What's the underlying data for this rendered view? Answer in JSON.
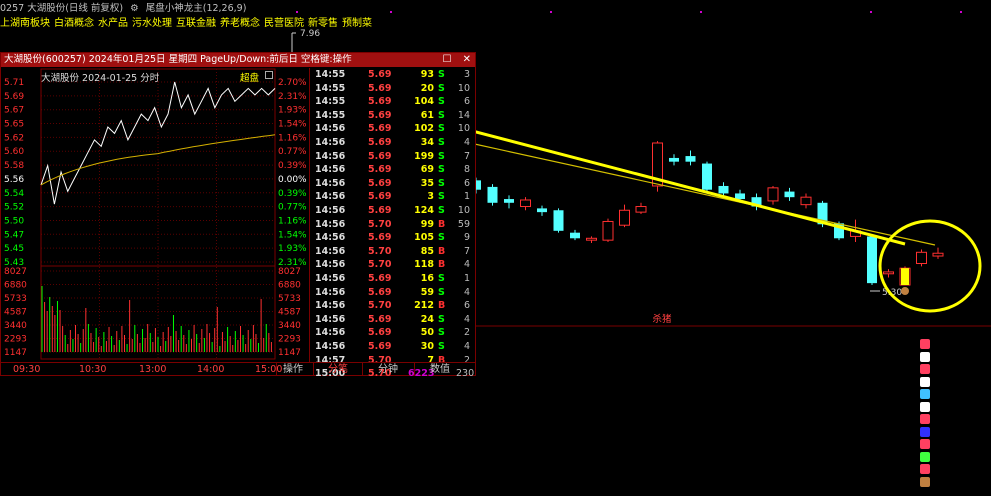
{
  "header": {
    "code_title": "0257 大湖股份(日线 前复权)",
    "indicator": "尾盘小神龙主(12,26,9)"
  },
  "tags": [
    "上湖南板块",
    "白酒概念",
    "水产品",
    "污水处理",
    "互联金融",
    "养老概念",
    "民营医院",
    "新零售",
    "预制菜"
  ],
  "main_chart": {
    "high_label": "7.96",
    "low_label": "5.30",
    "divider_label": "杀猪"
  },
  "popup": {
    "title": "大湖股份(600257) 2024年01月25日 星期四 PageUp/Down:前后日 空格键:操作",
    "sub_title": "大湖股份  2024-01-25 分时",
    "sub_tag": "超盘",
    "price_labels": [
      "5.71",
      "5.69",
      "5.67",
      "5.65",
      "5.62",
      "5.60",
      "5.58",
      "5.56",
      "5.54",
      "5.52",
      "5.50",
      "5.47",
      "5.45",
      "5.43"
    ],
    "pct_labels": [
      "2.70%",
      "2.31%",
      "1.93%",
      "1.54%",
      "1.16%",
      "0.77%",
      "0.39%",
      "0.00%",
      "0.39%",
      "0.77%",
      "1.16%",
      "1.54%",
      "1.93%",
      "2.31%"
    ],
    "vol_labels": [
      "8027",
      "6880",
      "5733",
      "4587",
      "3440",
      "2293",
      "1147"
    ],
    "time_labels": [
      "09:30",
      "10:30",
      "13:00",
      "14:00",
      "15:00"
    ],
    "bottom_tabs": [
      "操作",
      "分笔",
      "分钟",
      "数值"
    ]
  },
  "ticks": [
    {
      "time": "14:55",
      "price": "5.69",
      "vol": "93",
      "side": "S",
      "num": "3"
    },
    {
      "time": "14:55",
      "price": "5.69",
      "vol": "20",
      "side": "S",
      "num": "10"
    },
    {
      "time": "14:55",
      "price": "5.69",
      "vol": "104",
      "side": "S",
      "num": "6"
    },
    {
      "time": "14:55",
      "price": "5.69",
      "vol": "61",
      "side": "S",
      "num": "14"
    },
    {
      "time": "14:56",
      "price": "5.69",
      "vol": "102",
      "side": "S",
      "num": "10"
    },
    {
      "time": "14:56",
      "price": "5.69",
      "vol": "34",
      "side": "S",
      "num": "4"
    },
    {
      "time": "14:56",
      "price": "5.69",
      "vol": "199",
      "side": "S",
      "num": "7"
    },
    {
      "time": "14:56",
      "price": "5.69",
      "vol": "69",
      "side": "S",
      "num": "8"
    },
    {
      "time": "14:56",
      "price": "5.69",
      "vol": "35",
      "side": "S",
      "num": "6"
    },
    {
      "time": "14:56",
      "price": "5.69",
      "vol": "3",
      "side": "S",
      "num": "1"
    },
    {
      "time": "14:56",
      "price": "5.69",
      "vol": "124",
      "side": "S",
      "num": "10"
    },
    {
      "time": "14:56",
      "price": "5.70",
      "vol": "99",
      "side": "B",
      "num": "59"
    },
    {
      "time": "14:56",
      "price": "5.69",
      "vol": "105",
      "side": "S",
      "num": "9"
    },
    {
      "time": "14:56",
      "price": "5.70",
      "vol": "85",
      "side": "B",
      "num": "7"
    },
    {
      "time": "14:56",
      "price": "5.70",
      "vol": "118",
      "side": "B",
      "num": "4"
    },
    {
      "time": "14:56",
      "price": "5.69",
      "vol": "16",
      "side": "S",
      "num": "1"
    },
    {
      "time": "14:56",
      "price": "5.69",
      "vol": "59",
      "side": "S",
      "num": "4"
    },
    {
      "time": "14:56",
      "price": "5.70",
      "vol": "212",
      "side": "B",
      "num": "6"
    },
    {
      "time": "14:56",
      "price": "5.69",
      "vol": "24",
      "side": "S",
      "num": "4"
    },
    {
      "time": "14:56",
      "price": "5.69",
      "vol": "50",
      "side": "S",
      "num": "2"
    },
    {
      "time": "14:56",
      "price": "5.69",
      "vol": "30",
      "side": "S",
      "num": "4"
    },
    {
      "time": "14:57",
      "price": "5.70",
      "vol": "7",
      "side": "B",
      "num": "2"
    },
    {
      "time": "15:00",
      "price": "5.70",
      "vol": "6223",
      "side": "",
      "num": "230"
    }
  ],
  "colors": {
    "up": "#ff3030",
    "down": "#54ffff",
    "buy": "#ff3030",
    "sell": "#00ff00",
    "highlight": "#ffff00",
    "avg_line": "#d4b000",
    "price_line": "#ffffff"
  },
  "candles": [
    {
      "o": 6.42,
      "c": 6.32,
      "h": 6.45,
      "l": 6.28
    },
    {
      "o": 6.35,
      "c": 6.18,
      "h": 6.38,
      "l": 6.15
    },
    {
      "o": 6.22,
      "c": 6.18,
      "h": 6.26,
      "l": 6.12
    },
    {
      "o": 6.14,
      "c": 6.21,
      "h": 6.24,
      "l": 6.1
    },
    {
      "o": 6.12,
      "c": 6.08,
      "h": 6.15,
      "l": 6.04
    },
    {
      "o": 6.1,
      "c": 5.88,
      "h": 6.12,
      "l": 5.86
    },
    {
      "o": 5.86,
      "c": 5.8,
      "h": 5.89,
      "l": 5.78
    },
    {
      "o": 5.78,
      "c": 5.8,
      "h": 5.82,
      "l": 5.75
    },
    {
      "o": 5.78,
      "c": 5.98,
      "h": 6.01,
      "l": 5.76
    },
    {
      "o": 5.94,
      "c": 6.1,
      "h": 6.16,
      "l": 5.92
    },
    {
      "o": 6.08,
      "c": 6.14,
      "h": 6.18,
      "l": 6.06
    },
    {
      "o": 6.36,
      "c": 6.82,
      "h": 6.84,
      "l": 6.3
    },
    {
      "o": 6.66,
      "c": 6.62,
      "h": 6.7,
      "l": 6.58
    },
    {
      "o": 6.68,
      "c": 6.62,
      "h": 6.74,
      "l": 6.58
    },
    {
      "o": 6.6,
      "c": 6.32,
      "h": 6.62,
      "l": 6.3
    },
    {
      "o": 6.36,
      "c": 6.28,
      "h": 6.4,
      "l": 6.24
    },
    {
      "o": 6.28,
      "c": 6.22,
      "h": 6.32,
      "l": 6.18
    },
    {
      "o": 6.24,
      "c": 6.14,
      "h": 6.28,
      "l": 6.1
    },
    {
      "o": 6.2,
      "c": 6.34,
      "h": 6.36,
      "l": 6.16
    },
    {
      "o": 6.3,
      "c": 6.24,
      "h": 6.34,
      "l": 6.2
    },
    {
      "o": 6.16,
      "c": 6.24,
      "h": 6.28,
      "l": 6.12
    },
    {
      "o": 6.18,
      "c": 5.95,
      "h": 6.2,
      "l": 5.92
    },
    {
      "o": 5.96,
      "c": 5.8,
      "h": 5.98,
      "l": 5.78
    },
    {
      "o": 5.82,
      "c": 5.88,
      "h": 6.0,
      "l": 5.76
    },
    {
      "o": 5.82,
      "c": 5.32,
      "h": 5.84,
      "l": 5.3
    },
    {
      "o": 5.42,
      "c": 5.44,
      "h": 5.47,
      "l": 5.38
    },
    {
      "o": 5.3,
      "c": 5.48,
      "h": 5.5,
      "l": 5.3
    },
    {
      "o": 5.53,
      "c": 5.65,
      "h": 5.68,
      "l": 5.5
    },
    {
      "o": 5.61,
      "c": 5.64,
      "h": 5.7,
      "l": 5.58
    }
  ]
}
